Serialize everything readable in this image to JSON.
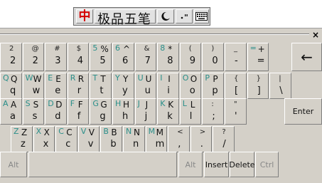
{
  "ime_toolbar": {
    "logo_char": "中",
    "name": "极品五笔",
    "moon_icon": "half-moon-icon",
    "punct_icon": "punctuation-icon",
    "keyboard_icon": "soft-keyboard-icon"
  },
  "window": {
    "close_label": "×"
  },
  "rows": [
    [
      {
        "shift": "2",
        "base": "2",
        "latin": ""
      },
      {
        "shift": "@",
        "base": "2",
        "latin": ""
      },
      {
        "shift": "#",
        "base": "3",
        "latin": ""
      },
      {
        "shift": "$",
        "base": "4",
        "latin": ""
      },
      {
        "shift": "%",
        "base": "5",
        "latin": "5"
      },
      {
        "shift": "^",
        "base": "6",
        "latin": "6"
      },
      {
        "shift": "&",
        "base": "7",
        "latin": ""
      },
      {
        "shift": "*",
        "base": "8",
        "latin": "8"
      },
      {
        "shift": "(",
        "base": "9",
        "latin": ""
      },
      {
        "shift": ")",
        "base": "0",
        "latin": ""
      },
      {
        "shift": "_",
        "base": "-",
        "latin": ""
      },
      {
        "shift": "+",
        "base": "=",
        "latin": "="
      }
    ],
    [
      {
        "shift": "Q",
        "base": "q",
        "latin": "Q"
      },
      {
        "shift": "W",
        "base": "w",
        "latin": "W"
      },
      {
        "shift": "E",
        "base": "e",
        "latin": "E"
      },
      {
        "shift": "R",
        "base": "r",
        "latin": "R"
      },
      {
        "shift": "T",
        "base": "t",
        "latin": "T"
      },
      {
        "shift": "Y",
        "base": "y",
        "latin": "Y"
      },
      {
        "shift": "U",
        "base": "u",
        "latin": "U"
      },
      {
        "shift": "I",
        "base": "i",
        "latin": "I"
      },
      {
        "shift": "O",
        "base": "o",
        "latin": "O"
      },
      {
        "shift": "P",
        "base": "p",
        "latin": "P"
      },
      {
        "shift": "{",
        "base": "[",
        "latin": ""
      },
      {
        "shift": "}",
        "base": "]",
        "latin": ""
      },
      {
        "shift": "|",
        "base": "\\",
        "latin": ""
      }
    ],
    [
      {
        "shift": "A",
        "base": "a",
        "latin": "A"
      },
      {
        "shift": "S",
        "base": "s",
        "latin": "S"
      },
      {
        "shift": "D",
        "base": "d",
        "latin": "D"
      },
      {
        "shift": "F",
        "base": "f",
        "latin": "F"
      },
      {
        "shift": "G",
        "base": "g",
        "latin": "G"
      },
      {
        "shift": "H",
        "base": "h",
        "latin": "H"
      },
      {
        "shift": "J",
        "base": "j",
        "latin": "J"
      },
      {
        "shift": "K",
        "base": "k",
        "latin": "K"
      },
      {
        "shift": "L",
        "base": "l",
        "latin": "L"
      },
      {
        "shift": ":",
        "base": ";",
        "latin": ""
      },
      {
        "shift": "\"",
        "base": "'",
        "latin": ""
      }
    ],
    [
      {
        "shift": "Z",
        "base": "z",
        "latin": "Z"
      },
      {
        "shift": "X",
        "base": "x",
        "latin": "X"
      },
      {
        "shift": "C",
        "base": "c",
        "latin": "C"
      },
      {
        "shift": "V",
        "base": "v",
        "latin": "V"
      },
      {
        "shift": "B",
        "base": "b",
        "latin": "B"
      },
      {
        "shift": "N",
        "base": "n",
        "latin": "N"
      },
      {
        "shift": "M",
        "base": "m",
        "latin": "M"
      },
      {
        "shift": "<",
        "base": ",",
        "latin": ""
      },
      {
        "shift": ">",
        "base": ".",
        "latin": ""
      },
      {
        "shift": "?",
        "base": "/",
        "latin": ""
      }
    ]
  ],
  "special_keys": {
    "backspace": "←",
    "enter": "Enter",
    "alt_left": "Alt",
    "alt_right": "Alt",
    "insert": "Insert",
    "delete": "Delete",
    "ctrl": "Ctrl"
  }
}
